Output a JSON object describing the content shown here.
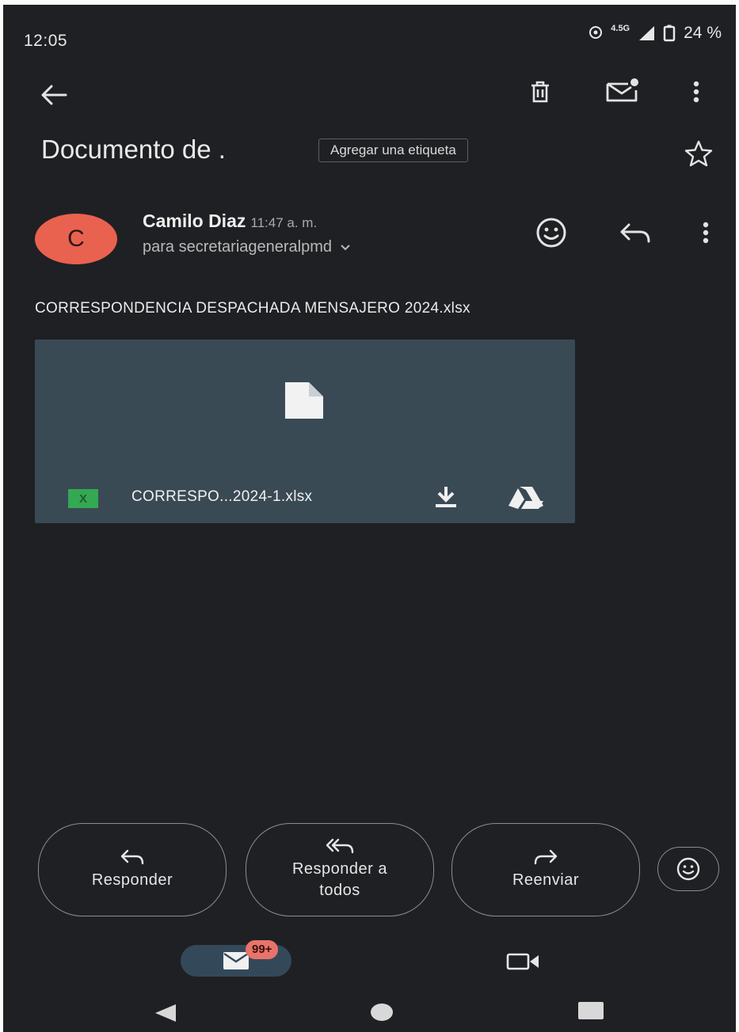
{
  "status_bar": {
    "time": "12:05",
    "network": "4.5G",
    "battery": "24 %"
  },
  "toolbar": {
    "back_icon": "arrow-left-icon",
    "delete_icon": "trash-icon",
    "mark_unread_icon": "mail-unread-icon",
    "more_icon": "more-vert-icon"
  },
  "email": {
    "subject": "Documento de .",
    "add_label": "Agregar una etiqueta",
    "star_icon": "star-outline-icon",
    "sender_initial": "C",
    "sender_name": "Camilo Diaz",
    "time": "11:47 a. m.",
    "recipient": "para secretariageneralpmd",
    "body": "CORRESPONDENCIA DESPACHADA MENSAJERO 2024.xlsx"
  },
  "attachment": {
    "file_type_icon": "X",
    "filename": "CORRESPO...2024-1.xlsx",
    "download_icon": "download-icon",
    "drive_icon": "drive-icon"
  },
  "actions": {
    "reply": "Responder",
    "reply_all_line1": "Responder a",
    "reply_all_line2": "todos",
    "forward": "Reenviar"
  },
  "bottom_nav": {
    "mail_badge": "99+"
  },
  "colors": {
    "background": "#1f2023",
    "avatar": "#e8624f",
    "attachment_bg": "#3a4a55",
    "badge": "#e9736a",
    "excel_green": "#34a853"
  }
}
